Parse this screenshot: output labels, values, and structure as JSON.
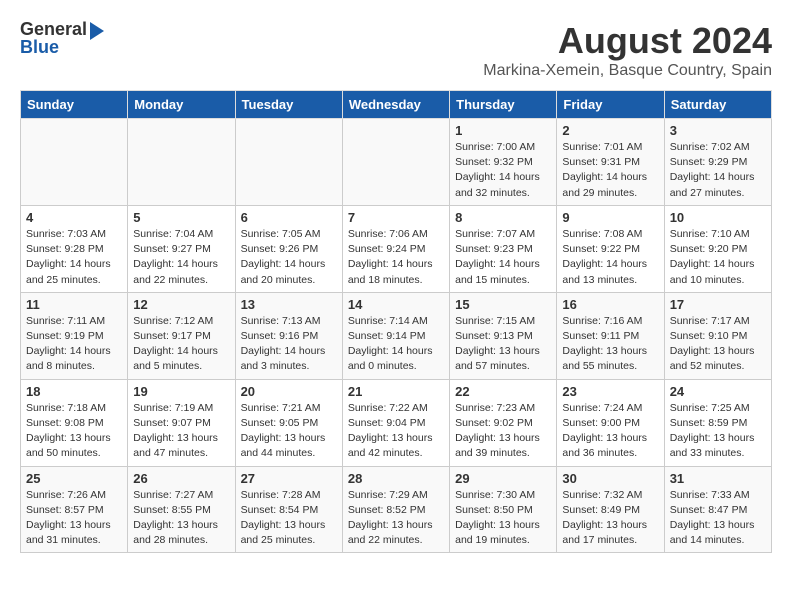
{
  "header": {
    "logo_line1": "General",
    "logo_line2": "Blue",
    "title": "August 2024",
    "subtitle": "Markina-Xemein, Basque Country, Spain"
  },
  "days_of_week": [
    "Sunday",
    "Monday",
    "Tuesday",
    "Wednesday",
    "Thursday",
    "Friday",
    "Saturday"
  ],
  "weeks": [
    [
      {
        "day": "",
        "info": ""
      },
      {
        "day": "",
        "info": ""
      },
      {
        "day": "",
        "info": ""
      },
      {
        "day": "",
        "info": ""
      },
      {
        "day": "1",
        "info": "Sunrise: 7:00 AM\nSunset: 9:32 PM\nDaylight: 14 hours\nand 32 minutes."
      },
      {
        "day": "2",
        "info": "Sunrise: 7:01 AM\nSunset: 9:31 PM\nDaylight: 14 hours\nand 29 minutes."
      },
      {
        "day": "3",
        "info": "Sunrise: 7:02 AM\nSunset: 9:29 PM\nDaylight: 14 hours\nand 27 minutes."
      }
    ],
    [
      {
        "day": "4",
        "info": "Sunrise: 7:03 AM\nSunset: 9:28 PM\nDaylight: 14 hours\nand 25 minutes."
      },
      {
        "day": "5",
        "info": "Sunrise: 7:04 AM\nSunset: 9:27 PM\nDaylight: 14 hours\nand 22 minutes."
      },
      {
        "day": "6",
        "info": "Sunrise: 7:05 AM\nSunset: 9:26 PM\nDaylight: 14 hours\nand 20 minutes."
      },
      {
        "day": "7",
        "info": "Sunrise: 7:06 AM\nSunset: 9:24 PM\nDaylight: 14 hours\nand 18 minutes."
      },
      {
        "day": "8",
        "info": "Sunrise: 7:07 AM\nSunset: 9:23 PM\nDaylight: 14 hours\nand 15 minutes."
      },
      {
        "day": "9",
        "info": "Sunrise: 7:08 AM\nSunset: 9:22 PM\nDaylight: 14 hours\nand 13 minutes."
      },
      {
        "day": "10",
        "info": "Sunrise: 7:10 AM\nSunset: 9:20 PM\nDaylight: 14 hours\nand 10 minutes."
      }
    ],
    [
      {
        "day": "11",
        "info": "Sunrise: 7:11 AM\nSunset: 9:19 PM\nDaylight: 14 hours\nand 8 minutes."
      },
      {
        "day": "12",
        "info": "Sunrise: 7:12 AM\nSunset: 9:17 PM\nDaylight: 14 hours\nand 5 minutes."
      },
      {
        "day": "13",
        "info": "Sunrise: 7:13 AM\nSunset: 9:16 PM\nDaylight: 14 hours\nand 3 minutes."
      },
      {
        "day": "14",
        "info": "Sunrise: 7:14 AM\nSunset: 9:14 PM\nDaylight: 14 hours\nand 0 minutes."
      },
      {
        "day": "15",
        "info": "Sunrise: 7:15 AM\nSunset: 9:13 PM\nDaylight: 13 hours\nand 57 minutes."
      },
      {
        "day": "16",
        "info": "Sunrise: 7:16 AM\nSunset: 9:11 PM\nDaylight: 13 hours\nand 55 minutes."
      },
      {
        "day": "17",
        "info": "Sunrise: 7:17 AM\nSunset: 9:10 PM\nDaylight: 13 hours\nand 52 minutes."
      }
    ],
    [
      {
        "day": "18",
        "info": "Sunrise: 7:18 AM\nSunset: 9:08 PM\nDaylight: 13 hours\nand 50 minutes."
      },
      {
        "day": "19",
        "info": "Sunrise: 7:19 AM\nSunset: 9:07 PM\nDaylight: 13 hours\nand 47 minutes."
      },
      {
        "day": "20",
        "info": "Sunrise: 7:21 AM\nSunset: 9:05 PM\nDaylight: 13 hours\nand 44 minutes."
      },
      {
        "day": "21",
        "info": "Sunrise: 7:22 AM\nSunset: 9:04 PM\nDaylight: 13 hours\nand 42 minutes."
      },
      {
        "day": "22",
        "info": "Sunrise: 7:23 AM\nSunset: 9:02 PM\nDaylight: 13 hours\nand 39 minutes."
      },
      {
        "day": "23",
        "info": "Sunrise: 7:24 AM\nSunset: 9:00 PM\nDaylight: 13 hours\nand 36 minutes."
      },
      {
        "day": "24",
        "info": "Sunrise: 7:25 AM\nSunset: 8:59 PM\nDaylight: 13 hours\nand 33 minutes."
      }
    ],
    [
      {
        "day": "25",
        "info": "Sunrise: 7:26 AM\nSunset: 8:57 PM\nDaylight: 13 hours\nand 31 minutes."
      },
      {
        "day": "26",
        "info": "Sunrise: 7:27 AM\nSunset: 8:55 PM\nDaylight: 13 hours\nand 28 minutes."
      },
      {
        "day": "27",
        "info": "Sunrise: 7:28 AM\nSunset: 8:54 PM\nDaylight: 13 hours\nand 25 minutes."
      },
      {
        "day": "28",
        "info": "Sunrise: 7:29 AM\nSunset: 8:52 PM\nDaylight: 13 hours\nand 22 minutes."
      },
      {
        "day": "29",
        "info": "Sunrise: 7:30 AM\nSunset: 8:50 PM\nDaylight: 13 hours\nand 19 minutes."
      },
      {
        "day": "30",
        "info": "Sunrise: 7:32 AM\nSunset: 8:49 PM\nDaylight: 13 hours\nand 17 minutes."
      },
      {
        "day": "31",
        "info": "Sunrise: 7:33 AM\nSunset: 8:47 PM\nDaylight: 13 hours\nand 14 minutes."
      }
    ]
  ]
}
